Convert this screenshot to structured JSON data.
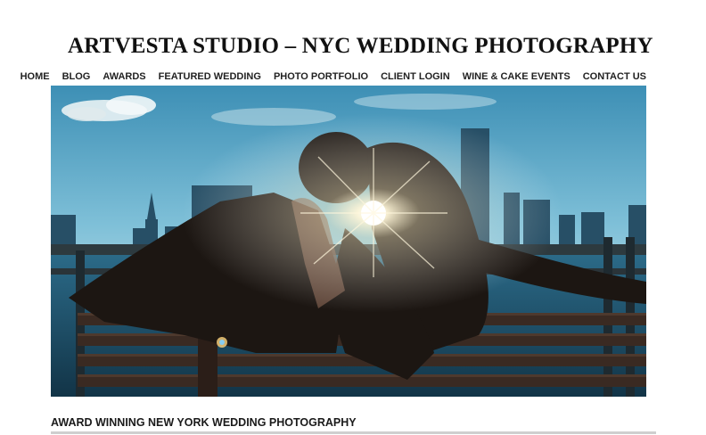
{
  "header": {
    "site_title": "ARTVESTA STUDIO – NYC WEDDING PHOTOGRAPHY"
  },
  "nav": {
    "items": [
      {
        "label": "HOME"
      },
      {
        "label": "BLOG"
      },
      {
        "label": "AWARDS"
      },
      {
        "label": "FEATURED WEDDING"
      },
      {
        "label": "PHOTO PORTFOLIO"
      },
      {
        "label": "CLIENT LOGIN"
      },
      {
        "label": "WINE & CAKE EVENTS"
      },
      {
        "label": "CONTACT US"
      }
    ]
  },
  "main": {
    "section_heading": "AWARD WINNING NEW YORK WEDDING PHOTOGRAPHY"
  }
}
